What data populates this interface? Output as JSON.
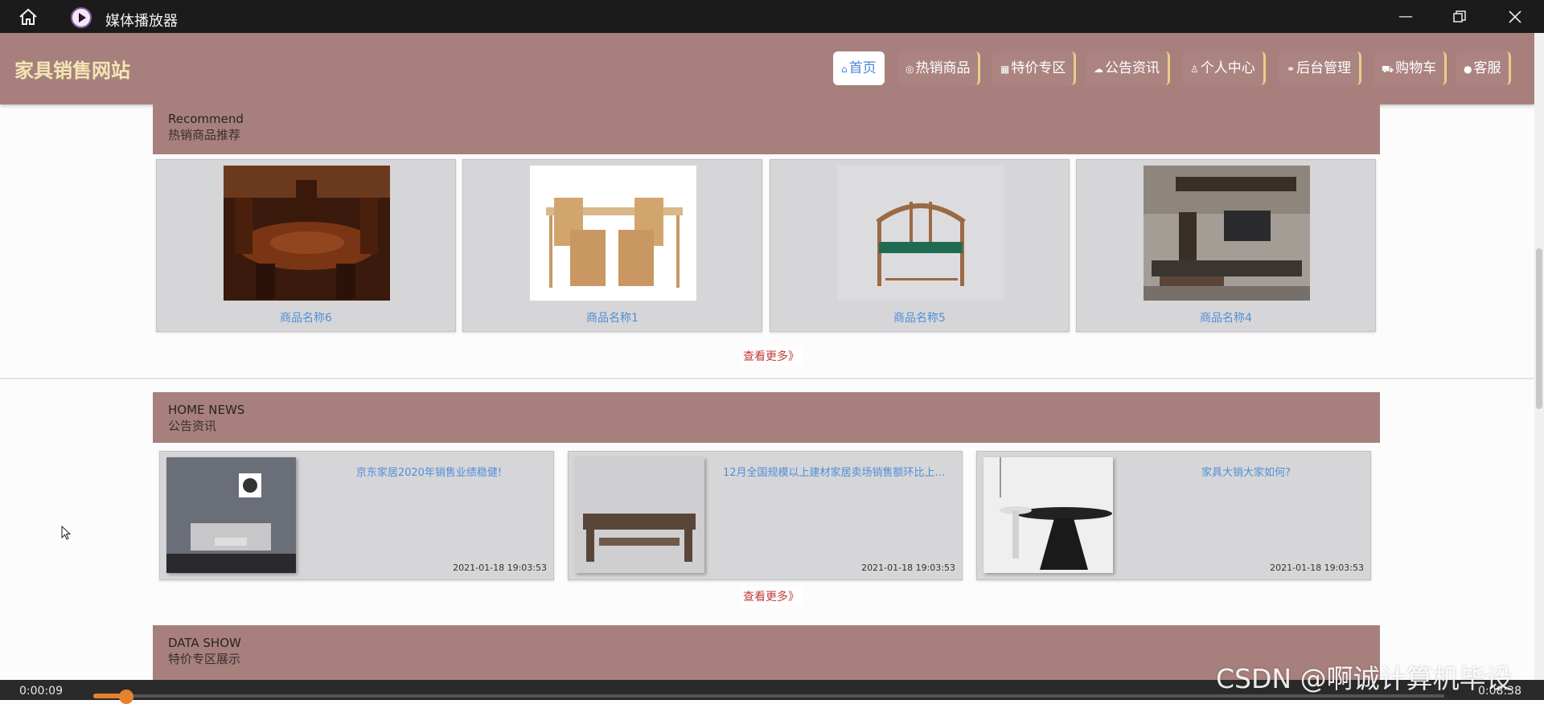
{
  "player": {
    "title": "媒体播放器",
    "time_current": "0:00:09",
    "time_total": "0:08:38",
    "progress": 0.02
  },
  "site": {
    "logo": "家具销售网站",
    "nav": [
      {
        "label": "首页",
        "icon": "home-outline-icon"
      },
      {
        "label": "热销商品",
        "icon": "fire-icon"
      },
      {
        "label": "特价专区",
        "icon": "gift-icon"
      },
      {
        "label": "公告资讯",
        "icon": "cloud-icon"
      },
      {
        "label": "个人中心",
        "icon": "user-icon"
      },
      {
        "label": "后台管理",
        "icon": "link-icon"
      },
      {
        "label": "购物车",
        "icon": "cart-icon"
      },
      {
        "label": "客服",
        "icon": "chat-icon"
      }
    ]
  },
  "recommend": {
    "title_en": "Recommend",
    "title_cn": "热销商品推荐",
    "products": [
      {
        "name": "商品名称6"
      },
      {
        "name": "商品名称1"
      },
      {
        "name": "商品名称5"
      },
      {
        "name": "商品名称4"
      }
    ],
    "more": "查看更多》"
  },
  "news": {
    "title_en": "HOME NEWS",
    "title_cn": "公告资讯",
    "items": [
      {
        "title": "京东家居2020年销售业绩稳健!",
        "date": "2021-01-18 19:03:53"
      },
      {
        "title": "12月全国规模以上建材家居卖场销售额环比上涨...",
        "date": "2021-01-18 19:03:53"
      },
      {
        "title": "家具大销大家如何?",
        "date": "2021-01-18 19:03:53"
      }
    ],
    "more": "查看更多》"
  },
  "datashow": {
    "title_en": "DATA SHOW",
    "title_cn": "特价专区展示"
  },
  "watermark": "CSDN @啊诚计算机毕设"
}
